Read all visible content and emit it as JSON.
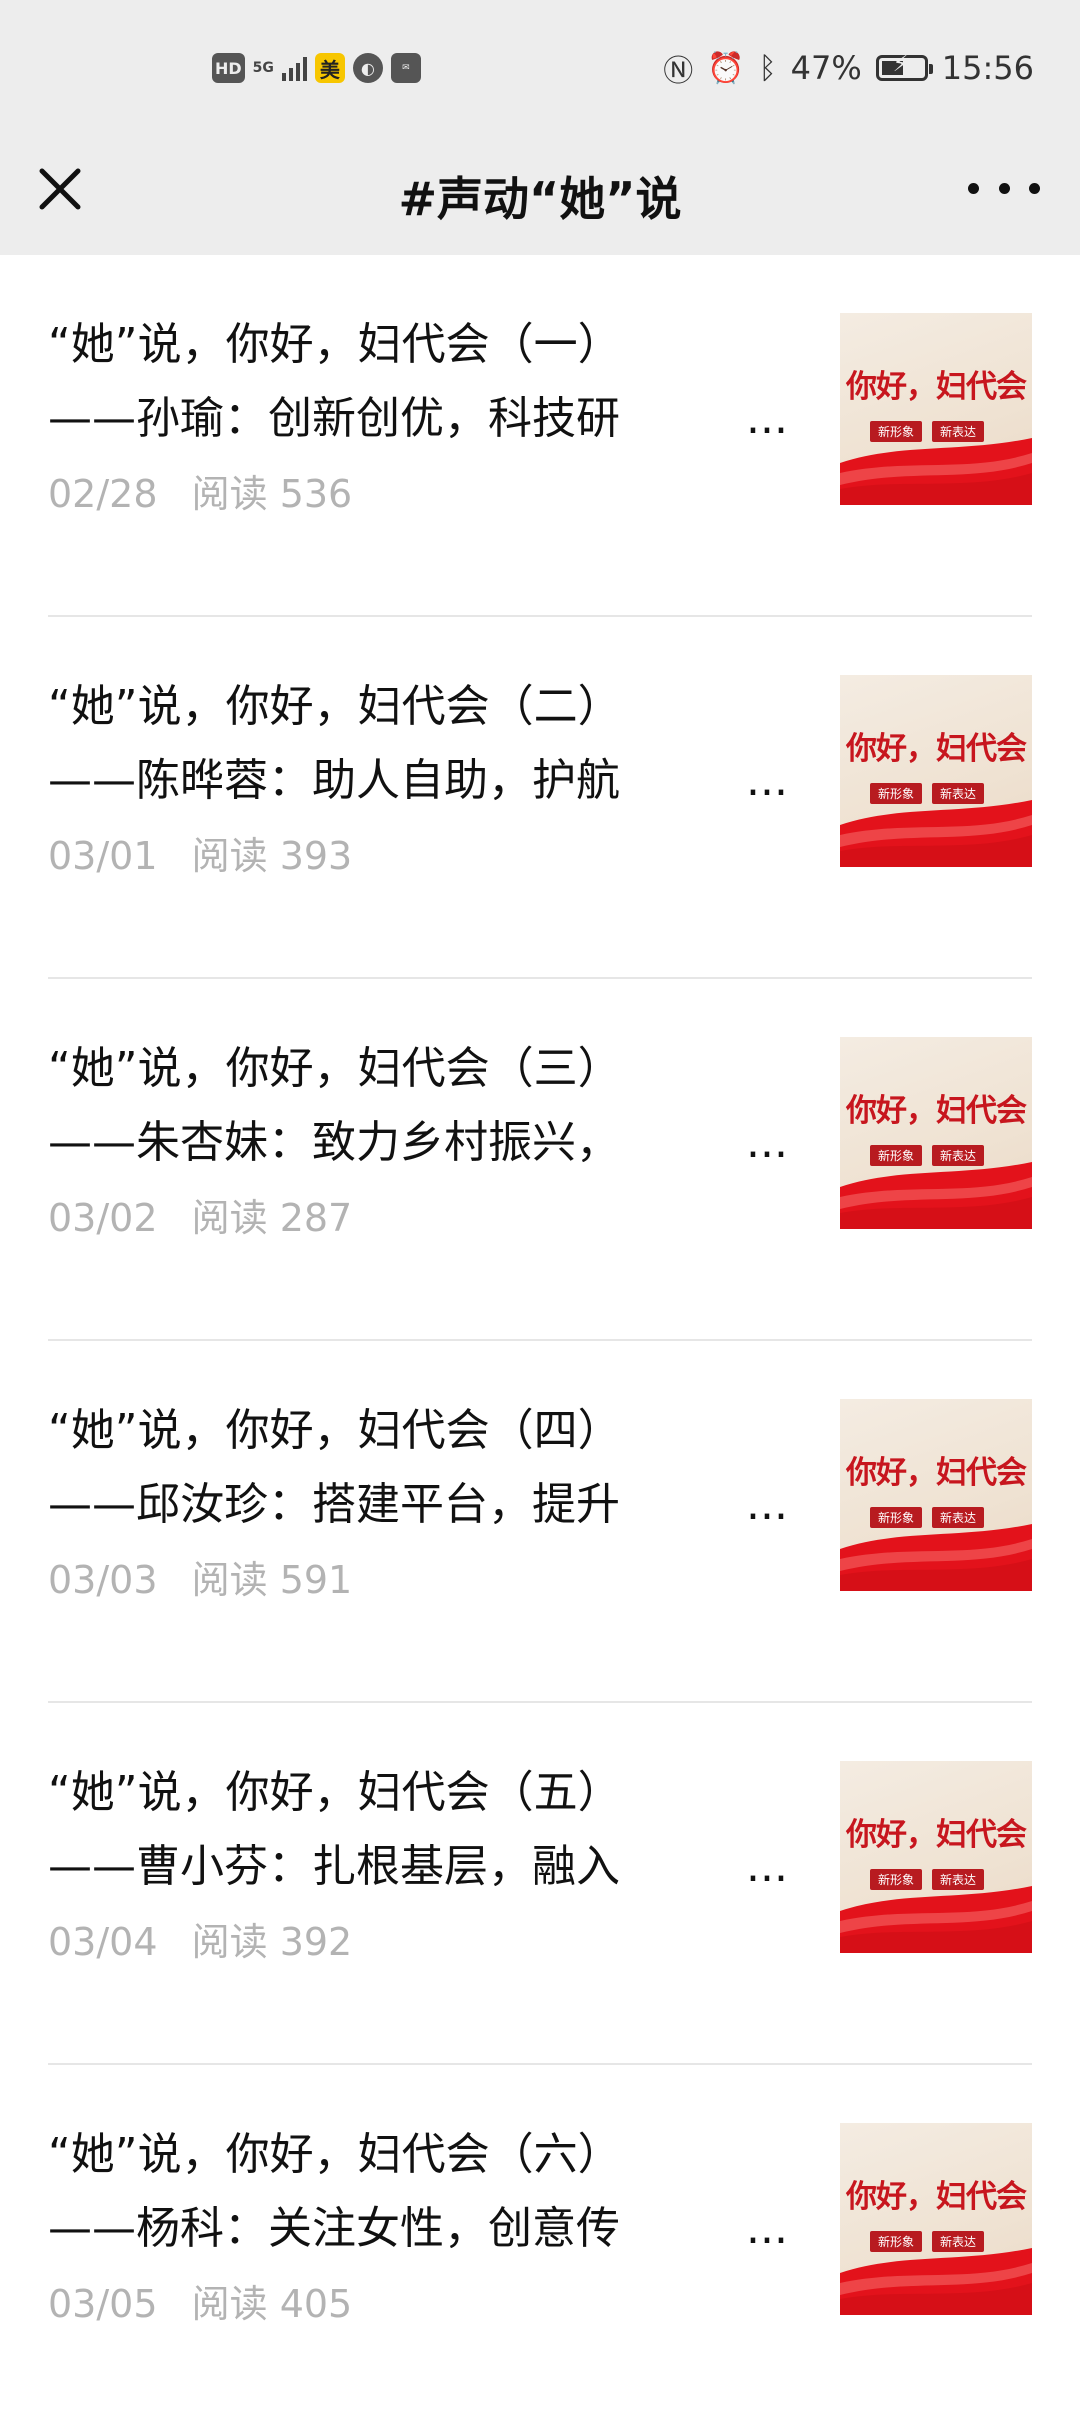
{
  "status_bar": {
    "left": {
      "hd": "HD",
      "network": "5G",
      "meituan": "美"
    },
    "right": {
      "battery": "47%",
      "time": "15:56"
    }
  },
  "nav": {
    "title": "#声动“她”说",
    "icons": {
      "close": "close-icon",
      "more": "more-icon"
    }
  },
  "articles": [
    {
      "title_line1": "“她”说，你好，妇代会（一）",
      "title_line2": "——孙瑜：创新创优，科技研",
      "ellipsis": "...",
      "date": "02/28",
      "reads": "阅读 536",
      "thumb_title": "你好，妇代会",
      "thumb_tag1": "新形象",
      "thumb_tag2": "新表达"
    },
    {
      "title_line1": "“她”说，你好，妇代会（二）",
      "title_line2": "——陈晔蓉：助人自助，护航",
      "ellipsis": "...",
      "date": "03/01",
      "reads": "阅读 393",
      "thumb_title": "你好，妇代会",
      "thumb_tag1": "新形象",
      "thumb_tag2": "新表达"
    },
    {
      "title_line1": "“她”说，你好，妇代会（三）",
      "title_line2": "——朱杏妹：致力乡村振兴，",
      "ellipsis": "...",
      "date": "03/02",
      "reads": "阅读 287",
      "thumb_title": "你好，妇代会",
      "thumb_tag1": "新形象",
      "thumb_tag2": "新表达"
    },
    {
      "title_line1": "“她”说，你好，妇代会（四）",
      "title_line2": "——邱汝珍：搭建平台，提升",
      "ellipsis": "...",
      "date": "03/03",
      "reads": "阅读 591",
      "thumb_title": "你好，妇代会",
      "thumb_tag1": "新形象",
      "thumb_tag2": "新表达"
    },
    {
      "title_line1": "“她”说，你好，妇代会（五）",
      "title_line2": "——曹小芬：扎根基层，融入",
      "ellipsis": "...",
      "date": "03/04",
      "reads": "阅读 392",
      "thumb_title": "你好，妇代会",
      "thumb_tag1": "新形象",
      "thumb_tag2": "新表达"
    },
    {
      "title_line1": "“她”说，你好，妇代会（六）",
      "title_line2": "——杨科：关注女性，创意传",
      "ellipsis": "...",
      "date": "03/05",
      "reads": "阅读 405",
      "thumb_title": "你好，妇代会",
      "thumb_tag1": "新形象",
      "thumb_tag2": "新表达"
    }
  ],
  "colors": {
    "accent_red": "#c7161e",
    "nav_bg": "#ededed",
    "meta_gray": "#b3b3b3"
  }
}
